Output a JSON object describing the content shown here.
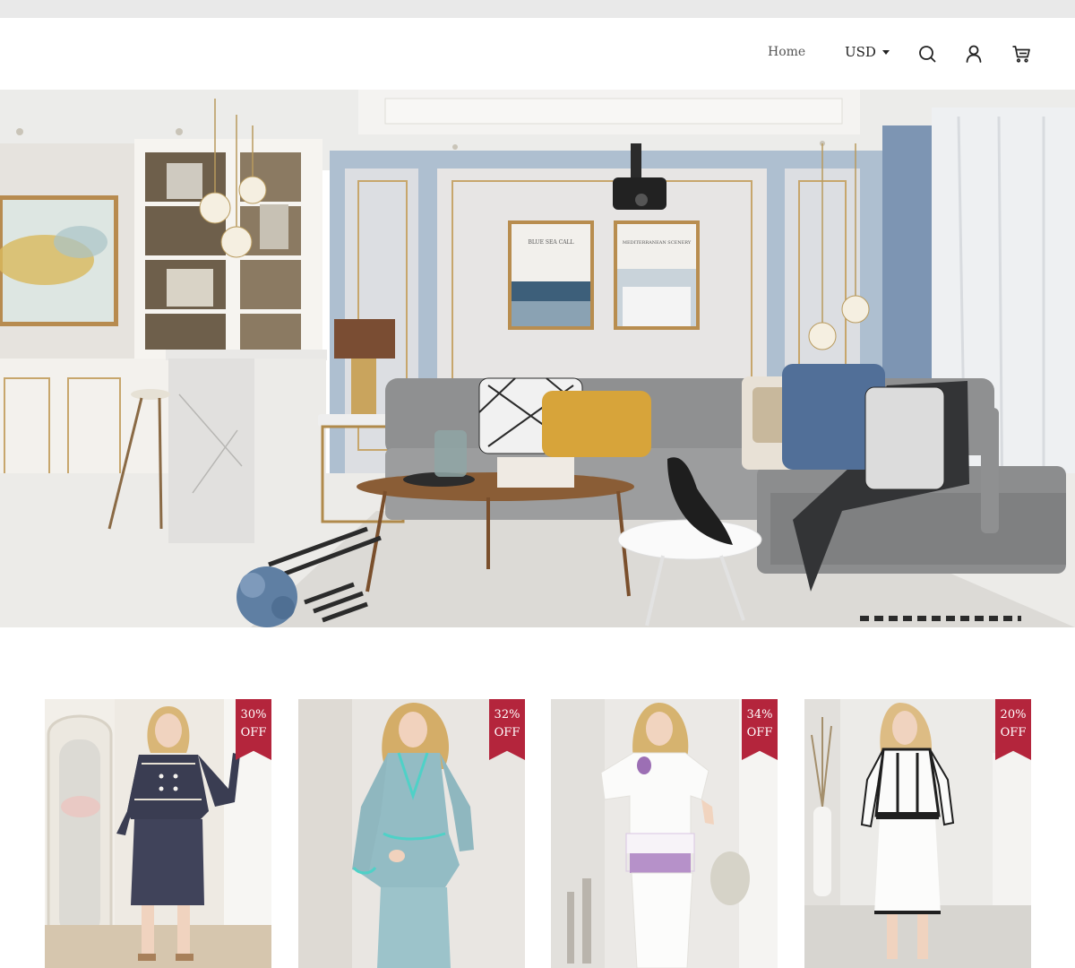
{
  "header": {
    "nav": {
      "home_label": "Home"
    },
    "currency": {
      "selected": "USD"
    },
    "icons": [
      "search-icon",
      "account-icon",
      "cart-icon"
    ]
  },
  "hero": {
    "art_left_text": "BLUE SEA CALL",
    "art_right_text": "MEDITERRANEAN SCENERY"
  },
  "products": [
    {
      "discount": "30%",
      "off_label": "OFF"
    },
    {
      "discount": "32%",
      "off_label": "OFF"
    },
    {
      "discount": "34%",
      "off_label": "OFF"
    },
    {
      "discount": "20%",
      "off_label": "OFF"
    }
  ],
  "colors": {
    "badge": "#b4253c",
    "top_strip": "#e9e9e9",
    "text_primary": "#222222",
    "text_nav": "#555555"
  }
}
